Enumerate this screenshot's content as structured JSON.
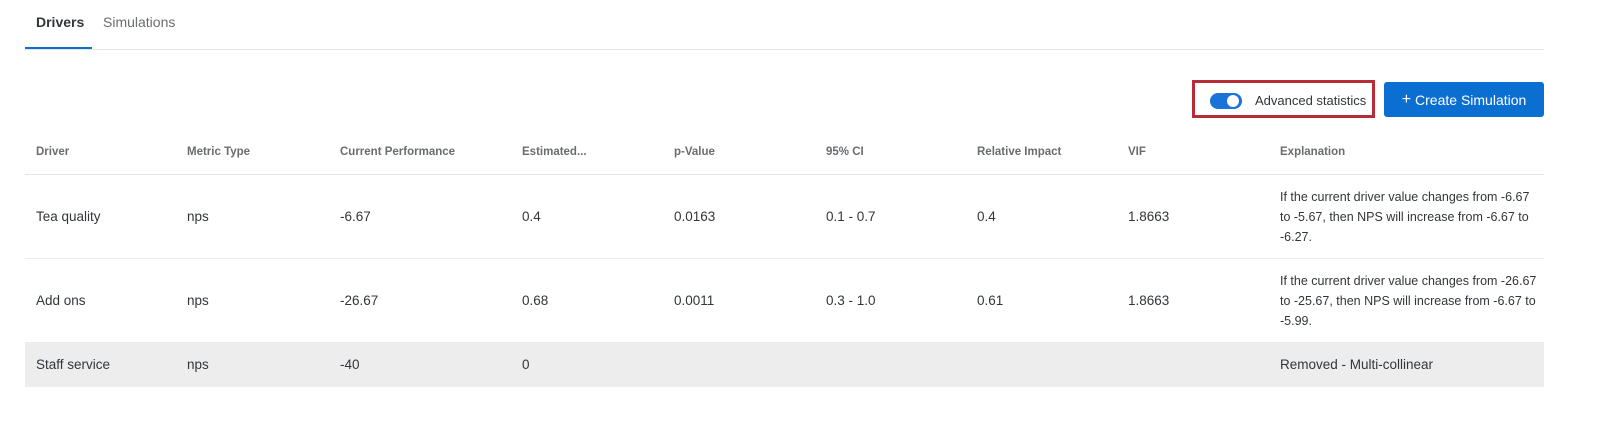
{
  "tabs": [
    {
      "label": "Drivers",
      "active": true
    },
    {
      "label": "Simulations",
      "active": false
    }
  ],
  "toolbar": {
    "advanced_label": "Advanced statistics",
    "advanced_enabled": true,
    "create_label": "Create Simulation",
    "create_icon": "plus-icon"
  },
  "table": {
    "columns": [
      "Driver",
      "Metric Type",
      "Current Performance",
      "Estimated...",
      "p-Value",
      "95% CI",
      "Relative Impact",
      "VIF",
      "Explanation"
    ],
    "rows": [
      {
        "driver": "Tea quality",
        "metric_type": "nps",
        "current_performance": "-6.67",
        "estimated": "0.4",
        "p_value": "0.0163",
        "ci": "0.1 - 0.7",
        "relative_impact": "0.4",
        "vif": "1.8663",
        "explanation": "If the current driver value changes from -6.67 to -5.67, then NPS will increase from -6.67 to -6.27."
      },
      {
        "driver": "Add ons",
        "metric_type": "nps",
        "current_performance": "-26.67",
        "estimated": "0.68",
        "p_value": "0.0011",
        "ci": "0.3 - 1.0",
        "relative_impact": "0.61",
        "vif": "1.8663",
        "explanation": "If the current driver value changes from -26.67 to -25.67, then NPS will increase from -6.67 to -5.99."
      },
      {
        "driver": "Staff service",
        "metric_type": "nps",
        "current_performance": "-40",
        "estimated": "0",
        "p_value": "",
        "ci": "",
        "relative_impact": "",
        "vif": "",
        "explanation": "Removed - Multi-collinear"
      }
    ]
  },
  "colors": {
    "accent": "#0b6ed1",
    "highlight_border": "#b72c36",
    "removed_row_bg": "#ededed"
  }
}
